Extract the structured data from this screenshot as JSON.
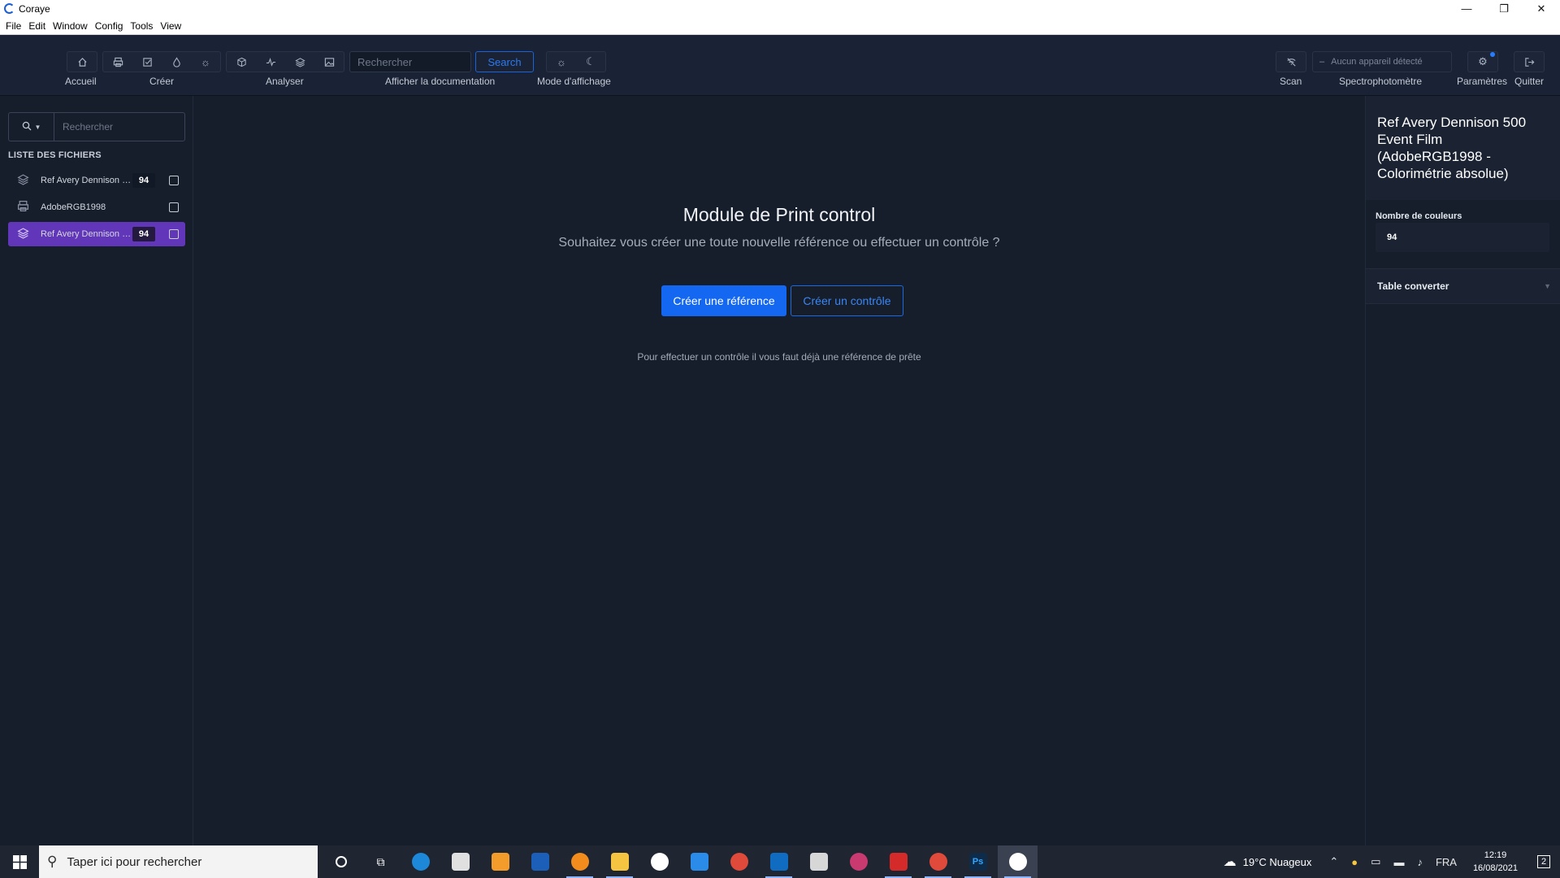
{
  "window": {
    "title": "Coraye",
    "controls": [
      "—",
      "❐",
      "✕"
    ]
  },
  "menu": [
    "File",
    "Edit",
    "Window",
    "Config",
    "Tools",
    "View"
  ],
  "toolbar": {
    "labels": {
      "home": "Accueil",
      "create": "Créer",
      "analyze": "Analyser",
      "docs": "Afficher la documentation",
      "display": "Mode d'affichage",
      "scan": "Scan",
      "spectro": "Spectrophotomètre",
      "settings": "Paramètres",
      "quit": "Quitter"
    },
    "search_placeholder": "Rechercher",
    "search_button": "Search",
    "device_status": "Aucun appareil détecté"
  },
  "sidebar": {
    "search_placeholder": "Rechercher",
    "list_title": "LISTE DES FICHIERS",
    "files": [
      {
        "name": "Ref Avery Dennison 500 Event Film",
        "count": "94",
        "icon": "layers-icon",
        "active": false
      },
      {
        "name": "AdobeRGB1998",
        "count": "",
        "icon": "printer-icon",
        "active": false
      },
      {
        "name": "Ref Avery Dennison 500 Event Film",
        "count": "94",
        "icon": "layers-icon",
        "active": true
      }
    ]
  },
  "main": {
    "title": "Module de Print control",
    "subtitle": "Souhaitez vous créer une toute nouvelle référence ou effectuer un contrôle ?",
    "primary_button": "Créer une référence",
    "secondary_button": "Créer un contrôle",
    "note": "Pour effectuer un contrôle il vous faut déjà une référence de prête"
  },
  "right_panel": {
    "title": "Ref Avery Dennison 500 Event Film (AdobeRGB1998 - Colorimétrie absolue)",
    "colors_label": "Nombre de couleurs",
    "colors_value": "94",
    "section_label": "Table converter"
  },
  "taskbar": {
    "search_placeholder": "Taper ici pour rechercher",
    "weather": "19°C  Nuageux",
    "language": "FRA",
    "time": "12:19",
    "date": "16/08/2021",
    "notifications": "2"
  },
  "colors": {
    "accent": "#1467f0",
    "active_item": "#6236b8",
    "background": "#161e2c"
  }
}
